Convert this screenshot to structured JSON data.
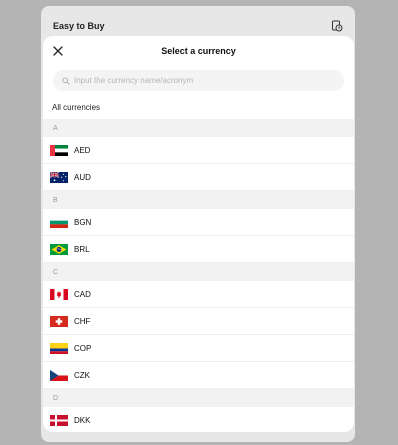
{
  "app": {
    "title": "Easy to Buy",
    "history_icon": "clock-history-icon"
  },
  "modal": {
    "title": "Select a currency",
    "close_icon": "close-icon",
    "search": {
      "placeholder": "Input the currency name/acronym",
      "value": "",
      "icon": "search-icon"
    },
    "section_label": "All currencies",
    "groups": [
      {
        "letter": "A",
        "items": [
          {
            "code": "AED",
            "flag": "flag-uae-icon"
          },
          {
            "code": "AUD",
            "flag": "flag-australia-icon"
          }
        ]
      },
      {
        "letter": "B",
        "items": [
          {
            "code": "BGN",
            "flag": "flag-bulgaria-icon"
          },
          {
            "code": "BRL",
            "flag": "flag-brazil-icon"
          }
        ]
      },
      {
        "letter": "C",
        "items": [
          {
            "code": "CAD",
            "flag": "flag-canada-icon"
          },
          {
            "code": "CHF",
            "flag": "flag-switzerland-icon"
          },
          {
            "code": "COP",
            "flag": "flag-colombia-icon"
          },
          {
            "code": "CZK",
            "flag": "flag-czech-icon"
          }
        ]
      },
      {
        "letter": "D",
        "items": [
          {
            "code": "DKK",
            "flag": "flag-denmark-icon"
          }
        ]
      }
    ]
  },
  "colors": {
    "backdrop": "#b4b4b4",
    "modal_background": "#ffffff",
    "group_header_background": "#f2f2f2"
  }
}
